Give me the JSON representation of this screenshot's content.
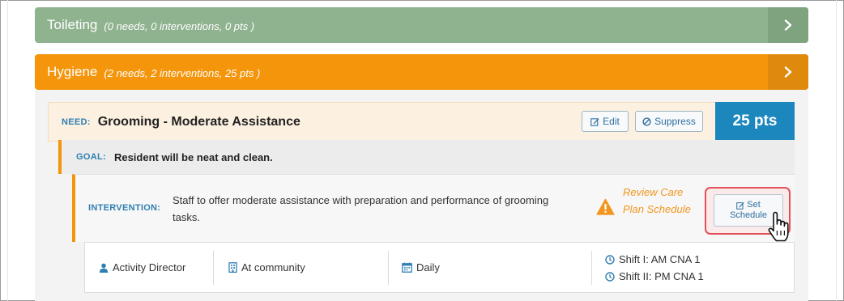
{
  "sections": {
    "toileting": {
      "title": "Toileting",
      "meta": "(0 needs, 0 interventions, 0 pts )",
      "expand_icon": "chevron-right-icon"
    },
    "hygiene": {
      "title": "Hygiene",
      "meta": "(2 needs, 2 interventions, 25 pts )",
      "expand_icon": "chevron-right-icon"
    }
  },
  "need": {
    "label": "NEED:",
    "title": "Grooming - Moderate Assistance",
    "edit_label": "Edit",
    "suppress_label": "Suppress",
    "points": "25 pts"
  },
  "goal": {
    "label": "GOAL:",
    "text": "Resident will be neat and clean."
  },
  "intervention": {
    "label": "INTERVENTION:",
    "text": "Staff to offer moderate assistance with preparation and performance of grooming tasks.",
    "warning_icon": "warning-triangle-icon",
    "review_link": "Review Care Plan Schedule",
    "set_schedule_line1": "Set",
    "set_schedule_line2": "Schedule"
  },
  "details": {
    "responsible": "Activity Director",
    "location": "At community",
    "frequency": "Daily",
    "shift1": "Shift I: AM CNA 1",
    "shift2": "Shift II: PM CNA 1"
  },
  "colors": {
    "toileting": "#8fb28f",
    "hygiene": "#f5950b",
    "points_bg": "#1c87bd",
    "label_blue": "#2f7fb2",
    "highlight": "#e25059"
  }
}
